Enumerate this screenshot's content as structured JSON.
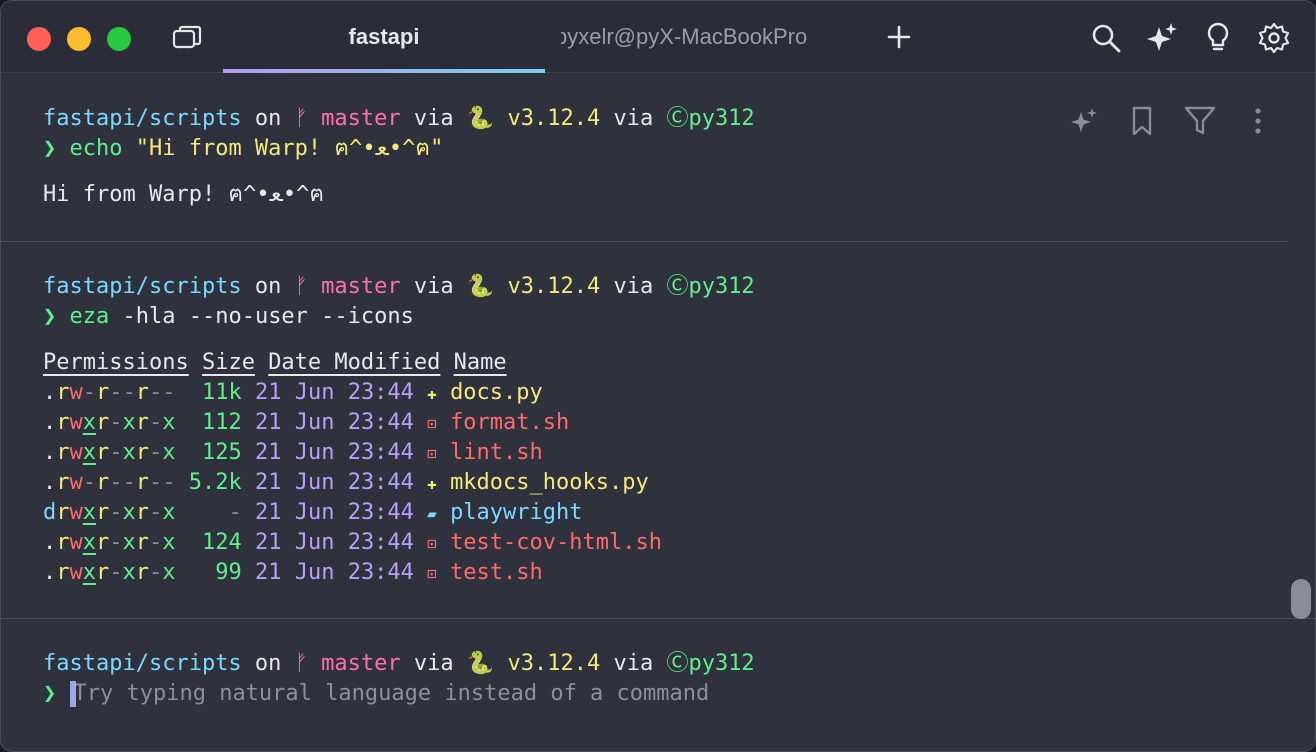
{
  "titlebar": {
    "active_tab": "fastapi",
    "inactive_tab": "pyxelr@pyX-MacBookPro",
    "icons": [
      "panel-icon",
      "plus-icon",
      "search-icon",
      "sparkles-icon",
      "lightbulb-icon",
      "gear-icon"
    ]
  },
  "prompt": {
    "dir": "fastapi/scripts",
    "on": " on ",
    "branch_icon": "ᚠ",
    "branch": " master",
    "via1": " via ",
    "snake": "🐍",
    "py_version": " v3.12.4",
    "via2": " via ",
    "env_icon": "Ⓒ",
    "env": "py312",
    "arrow": "❯"
  },
  "block1": {
    "cmd": "echo",
    "arg": " \"Hi from Warp! ฅ^•ﻌ•^ฅ\"",
    "output": "Hi from Warp! ฅ^•ﻌ•^ฅ",
    "actions": [
      "sparkles-icon",
      "bookmark-icon",
      "filter-icon",
      "more-icon"
    ]
  },
  "block2": {
    "cmd": "eza",
    "args": " -hla --no-user --icons",
    "headers": [
      "Permissions",
      "Size",
      "Date Modified",
      "Name"
    ],
    "rows": [
      {
        "perm": ".rw-r--r--",
        "size": "11k",
        "date": "21 Jun 23:44",
        "icon": "✚",
        "name": "docs.py",
        "kind": "py"
      },
      {
        "perm": ".rwxr-xr-x",
        "size": "112",
        "date": "21 Jun 23:44",
        "icon": "⊡",
        "name": "format.sh",
        "kind": "sh"
      },
      {
        "perm": ".rwxr-xr-x",
        "size": "125",
        "date": "21 Jun 23:44",
        "icon": "⊡",
        "name": "lint.sh",
        "kind": "sh"
      },
      {
        "perm": ".rw-r--r--",
        "size": "5.2k",
        "date": "21 Jun 23:44",
        "icon": "✚",
        "name": "mkdocs_hooks.py",
        "kind": "py"
      },
      {
        "perm": "drwxr-xr-x",
        "size": "-",
        "date": "21 Jun 23:44",
        "icon": "▰",
        "name": "playwright",
        "kind": "dir"
      },
      {
        "perm": ".rwxr-xr-x",
        "size": "124",
        "date": "21 Jun 23:44",
        "icon": "⊡",
        "name": "test-cov-html.sh",
        "kind": "sh"
      },
      {
        "perm": ".rwxr-xr-x",
        "size": "99",
        "date": "21 Jun 23:44",
        "icon": "⊡",
        "name": "test.sh",
        "kind": "sh"
      }
    ]
  },
  "input": {
    "placeholder": "Try typing natural language instead of a command"
  },
  "colors": {
    "background": "#2f313d",
    "cyan": "#7ad9ff",
    "pink": "#ff6fb0",
    "yellow": "#f5e97a",
    "green": "#5ef08a",
    "purple": "#b8a0f8",
    "red": "#ff6b6b"
  }
}
